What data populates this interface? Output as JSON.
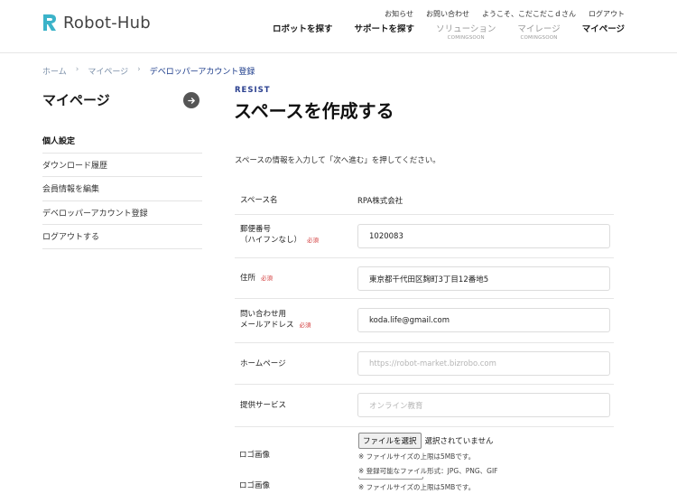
{
  "header": {
    "brand": "Robot-Hub",
    "top_links": [
      "お知らせ",
      "お問い合わせ",
      "ようこそ、こだこだこｄさん",
      "ログアウト"
    ],
    "nav": [
      {
        "label": "ロボットを探す",
        "sub": ""
      },
      {
        "label": "サポートを探す",
        "sub": ""
      },
      {
        "label": "ソリューション",
        "sub": "COMINGSOON"
      },
      {
        "label": "マイレージ",
        "sub": "COMINGSOON"
      },
      {
        "label": "マイページ",
        "sub": ""
      }
    ],
    "colors": {
      "logo_accent": "#3bb3c9"
    }
  },
  "breadcrumb": {
    "home": "ホーム",
    "mypage": "マイページ",
    "current": "デベロッパーアカウント登録"
  },
  "sidebar": {
    "title": "マイページ",
    "items": [
      "個人設定",
      "ダウンロード履歴",
      "会員情報を編集",
      "デベロッパーアカウント登録",
      "ログアウトする"
    ]
  },
  "main": {
    "eyebrow": "RESIST",
    "title": "スペースを作成する",
    "intro": "スペースの情報を入力して「次へ進む」を押してください。",
    "required_label": "必須",
    "fields": {
      "space_name": {
        "label": "スペース名",
        "value": "RPA株式会社"
      },
      "postal": {
        "label1": "郵便番号",
        "label2": "（ハイフンなし）",
        "value": "1020083"
      },
      "address": {
        "label": "住所",
        "value": "東京都千代田区麹町3丁目12番地5"
      },
      "email": {
        "label1": "問い合わせ用",
        "label2": "メールアドレス",
        "value": "koda.life@gmail.com"
      },
      "homepage": {
        "label": "ホームページ",
        "placeholder": "https://robot-market.bizrobo.com"
      },
      "service": {
        "label": "提供サービス",
        "placeholder": "オンライン教育"
      }
    },
    "logo_upload": {
      "label": "ロゴ画像",
      "button": "ファイルを選択",
      "status": "選択されていません",
      "note_size": "※ ファイルサイズの上限は5MBです。",
      "note_format": "※ 登録可能なファイル形式：JPG、PNG、GIF"
    },
    "logo_upload_2": {
      "label": "ロゴ画像",
      "note_size": "※ ファイルサイズの上限は5MBです。"
    }
  }
}
